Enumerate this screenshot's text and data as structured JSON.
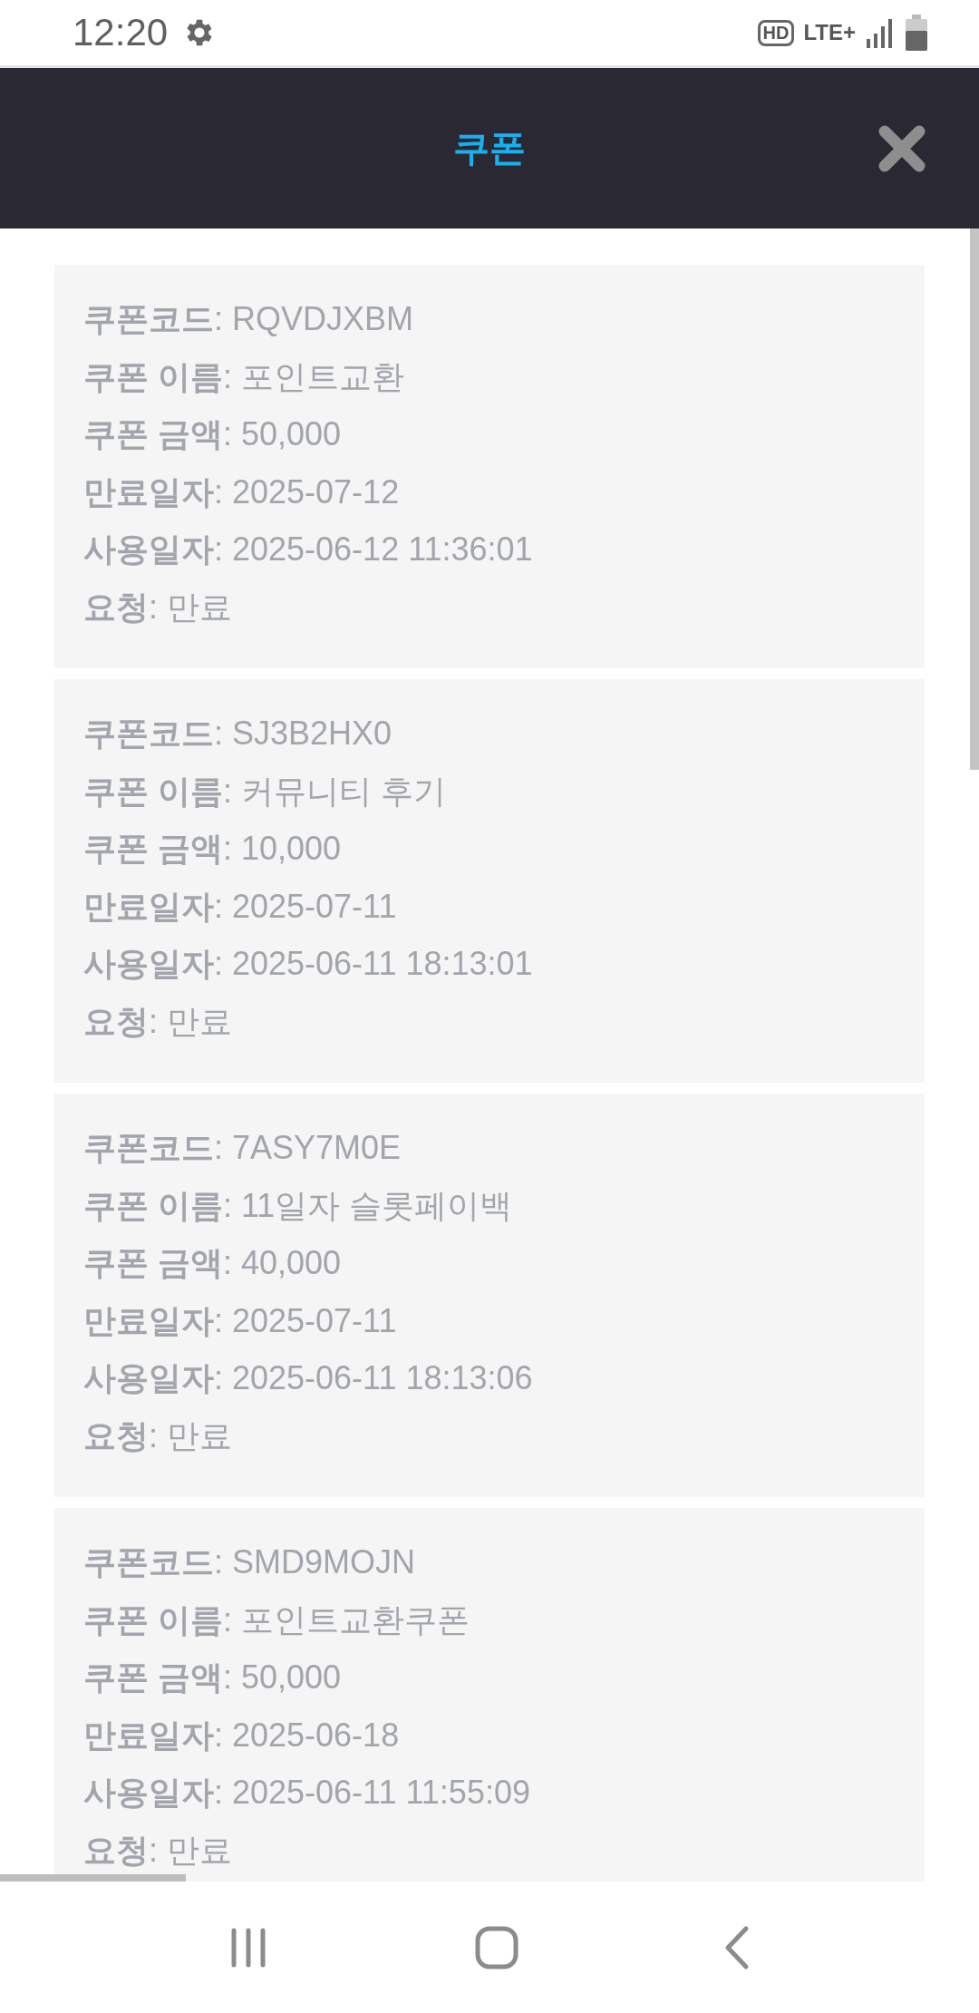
{
  "status_bar": {
    "time": "12:20",
    "hd": "HD",
    "network": "LTE+"
  },
  "header": {
    "title": "쿠폰"
  },
  "coupons": [
    {
      "lines": [
        "**쿠폰코드**: RQVDJXBM",
        "**쿠폰 이름**: 포인트교환",
        "**쿠폰 금액**: 50,000",
        "**만료일자**: 2025-07-12",
        "**사용일자**: 2025-06-12 11:36:01",
        "**요청**: 만료"
      ]
    },
    {
      "lines": [
        "**쿠폰코드**: SJ3B2HX0",
        "**쿠폰 이름**: 커뮤니티 후기",
        "**쿠폰 금액**: 10,000",
        "**만료일자**: 2025-07-11",
        "**사용일자**: 2025-06-11 18:13:01",
        "**요청**: 만료"
      ]
    },
    {
      "lines": [
        "**쿠폰코드**: 7ASY7M0E",
        "**쿠폰 이름**: 11일자 슬롯페이백",
        "**쿠폰 금액**: 40,000",
        "**만료일자**: 2025-07-11",
        "**사용일자**: 2025-06-11 18:13:06",
        "**요청**: 만료"
      ]
    },
    {
      "lines": [
        "**쿠폰코드**: SMD9MOJN",
        "**쿠폰 이름**: 포인트교환쿠폰",
        "**쿠폰 금액**: 50,000",
        "**만료일자**: 2025-06-18",
        "**사용일자**: 2025-06-11 11:55:09",
        "**요청**: 만료"
      ]
    }
  ]
}
